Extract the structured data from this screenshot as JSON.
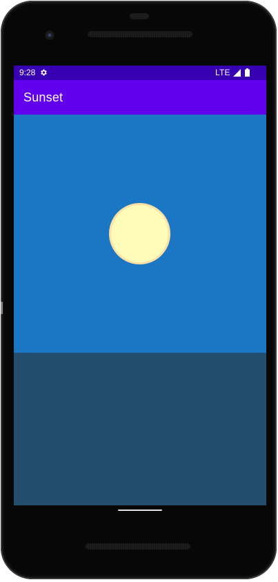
{
  "status_bar": {
    "time": "9:28",
    "network": "LTE",
    "settings_icon": "gear-icon",
    "signal_icon": "signal-icon",
    "battery_icon": "battery-icon",
    "color": "#3700b3"
  },
  "app_bar": {
    "title": "Sunset",
    "color": "#6200ee"
  },
  "scene": {
    "sky_color": "#1b76c3",
    "sun_color": "#fffcba",
    "sun_outline_color": "#fde0a5",
    "sea_color": "#224d6d"
  }
}
